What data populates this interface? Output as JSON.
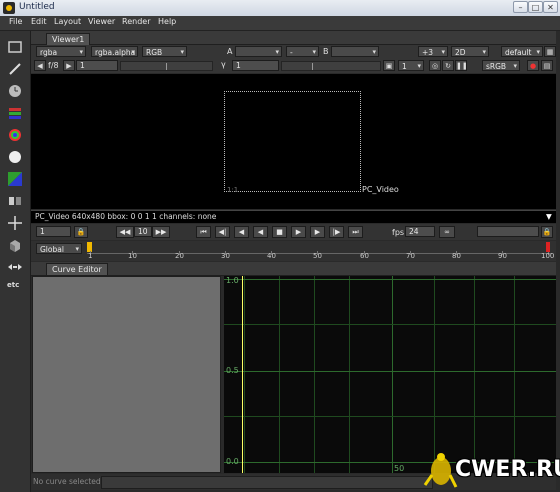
{
  "window": {
    "title": "Untitled"
  },
  "menu": [
    "File",
    "Edit",
    "Layout",
    "Viewer",
    "Render",
    "Help"
  ],
  "viewer": {
    "tab_label": "Viewer1",
    "channels": "rgba",
    "alpha_channel": "rgba.alpha",
    "display_channels": "RGB",
    "input_a_label": "A",
    "input_a_op": "-",
    "input_b_label": "B",
    "zoom_level": "+3",
    "view_mode": "2D",
    "layout": "default",
    "fstop_label": "f/8",
    "gain_value": "1",
    "gamma_label": "γ",
    "gamma_value": "1",
    "proxy_value": "1",
    "colorspace": "sRGB",
    "format_label": "1:1",
    "node_label": "PC_Video",
    "status": "PC_Video 640x480 bbox: 0 0 1 1 channels: none"
  },
  "playback": {
    "current_frame": "1",
    "step": "10",
    "fps_label": "fps",
    "fps": "24",
    "scope": "Global",
    "timeline_ticks": [
      "1",
      "10",
      "20",
      "30",
      "40",
      "50",
      "60",
      "70",
      "80",
      "90",
      "100"
    ],
    "timeline_range": [
      1,
      100
    ]
  },
  "curve_editor": {
    "tab_label": "Curve Editor",
    "y_labels": [
      "1.0",
      "0.5",
      "0.0"
    ],
    "x_label": "50",
    "status": "No curve selected"
  },
  "watermark": "CWER.RU",
  "colors": {
    "accent": "#f0b800",
    "grid": "#1f4a1f",
    "playhead": "#ffff66"
  }
}
